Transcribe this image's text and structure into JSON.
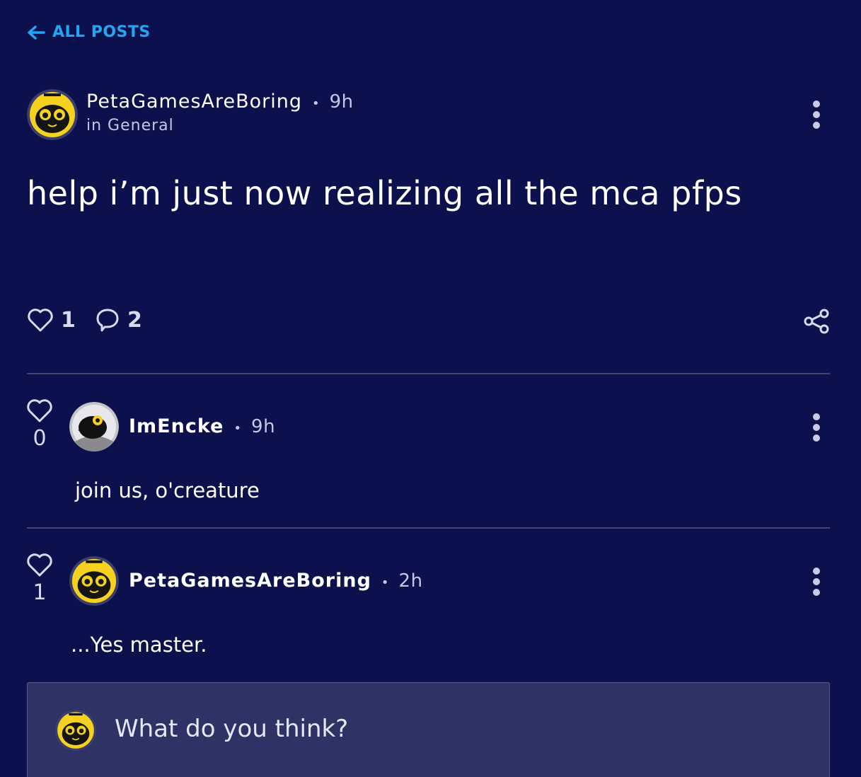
{
  "nav": {
    "back_label": "ALL POSTS",
    "back_icon": "arrow-left-icon"
  },
  "post": {
    "author": "PetaGamesAreBoring",
    "separator": "•",
    "time": "9h",
    "category": "in General",
    "title": "help i’m just now realizing all the mca pfps",
    "likes": "1",
    "comments": "2"
  },
  "comments": [
    {
      "author": "ImEncke",
      "separator": "•",
      "time": "9h",
      "likes": "0",
      "text": "join us, o'creature"
    },
    {
      "author": "PetaGamesAreBoring",
      "separator": "•",
      "time": "2h",
      "likes": "1",
      "text": "...Yes master."
    }
  ],
  "reply": {
    "placeholder": "What do you think?"
  },
  "colors": {
    "background": "#0c104c",
    "accent": "#22a6f2",
    "reply_box": "#2f3265",
    "divider": "#41456f",
    "avatar_yellow": "#f5d21f"
  }
}
